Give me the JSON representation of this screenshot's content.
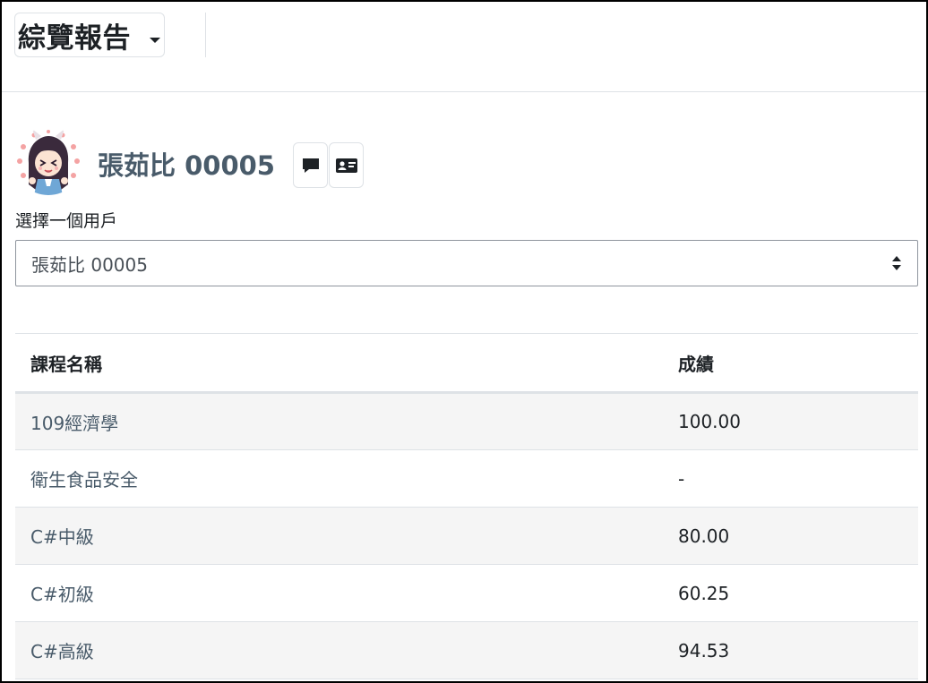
{
  "header": {
    "report_title": "綜覽報告"
  },
  "user": {
    "name": "張茹比 00005"
  },
  "user_selector": {
    "label": "選擇一個用戶",
    "selected": "張茹比 00005"
  },
  "table": {
    "columns": [
      "課程名稱",
      "成績"
    ],
    "rows": [
      {
        "course": "109經濟學",
        "grade": "100.00"
      },
      {
        "course": "衛生食品安全",
        "grade": "-"
      },
      {
        "course": "C#中級",
        "grade": "80.00"
      },
      {
        "course": "C#初級",
        "grade": "60.25"
      },
      {
        "course": "C#高級",
        "grade": "94.53"
      }
    ]
  },
  "icons": {
    "message": "message-icon",
    "profile": "id-card-icon",
    "dropdown": "chevron-down-icon",
    "select_arrows": "sort-arrows-icon"
  },
  "colors": {
    "user_name": "#495b6a",
    "striped_row": "#f5f5f5",
    "border": "#dee2e6"
  }
}
